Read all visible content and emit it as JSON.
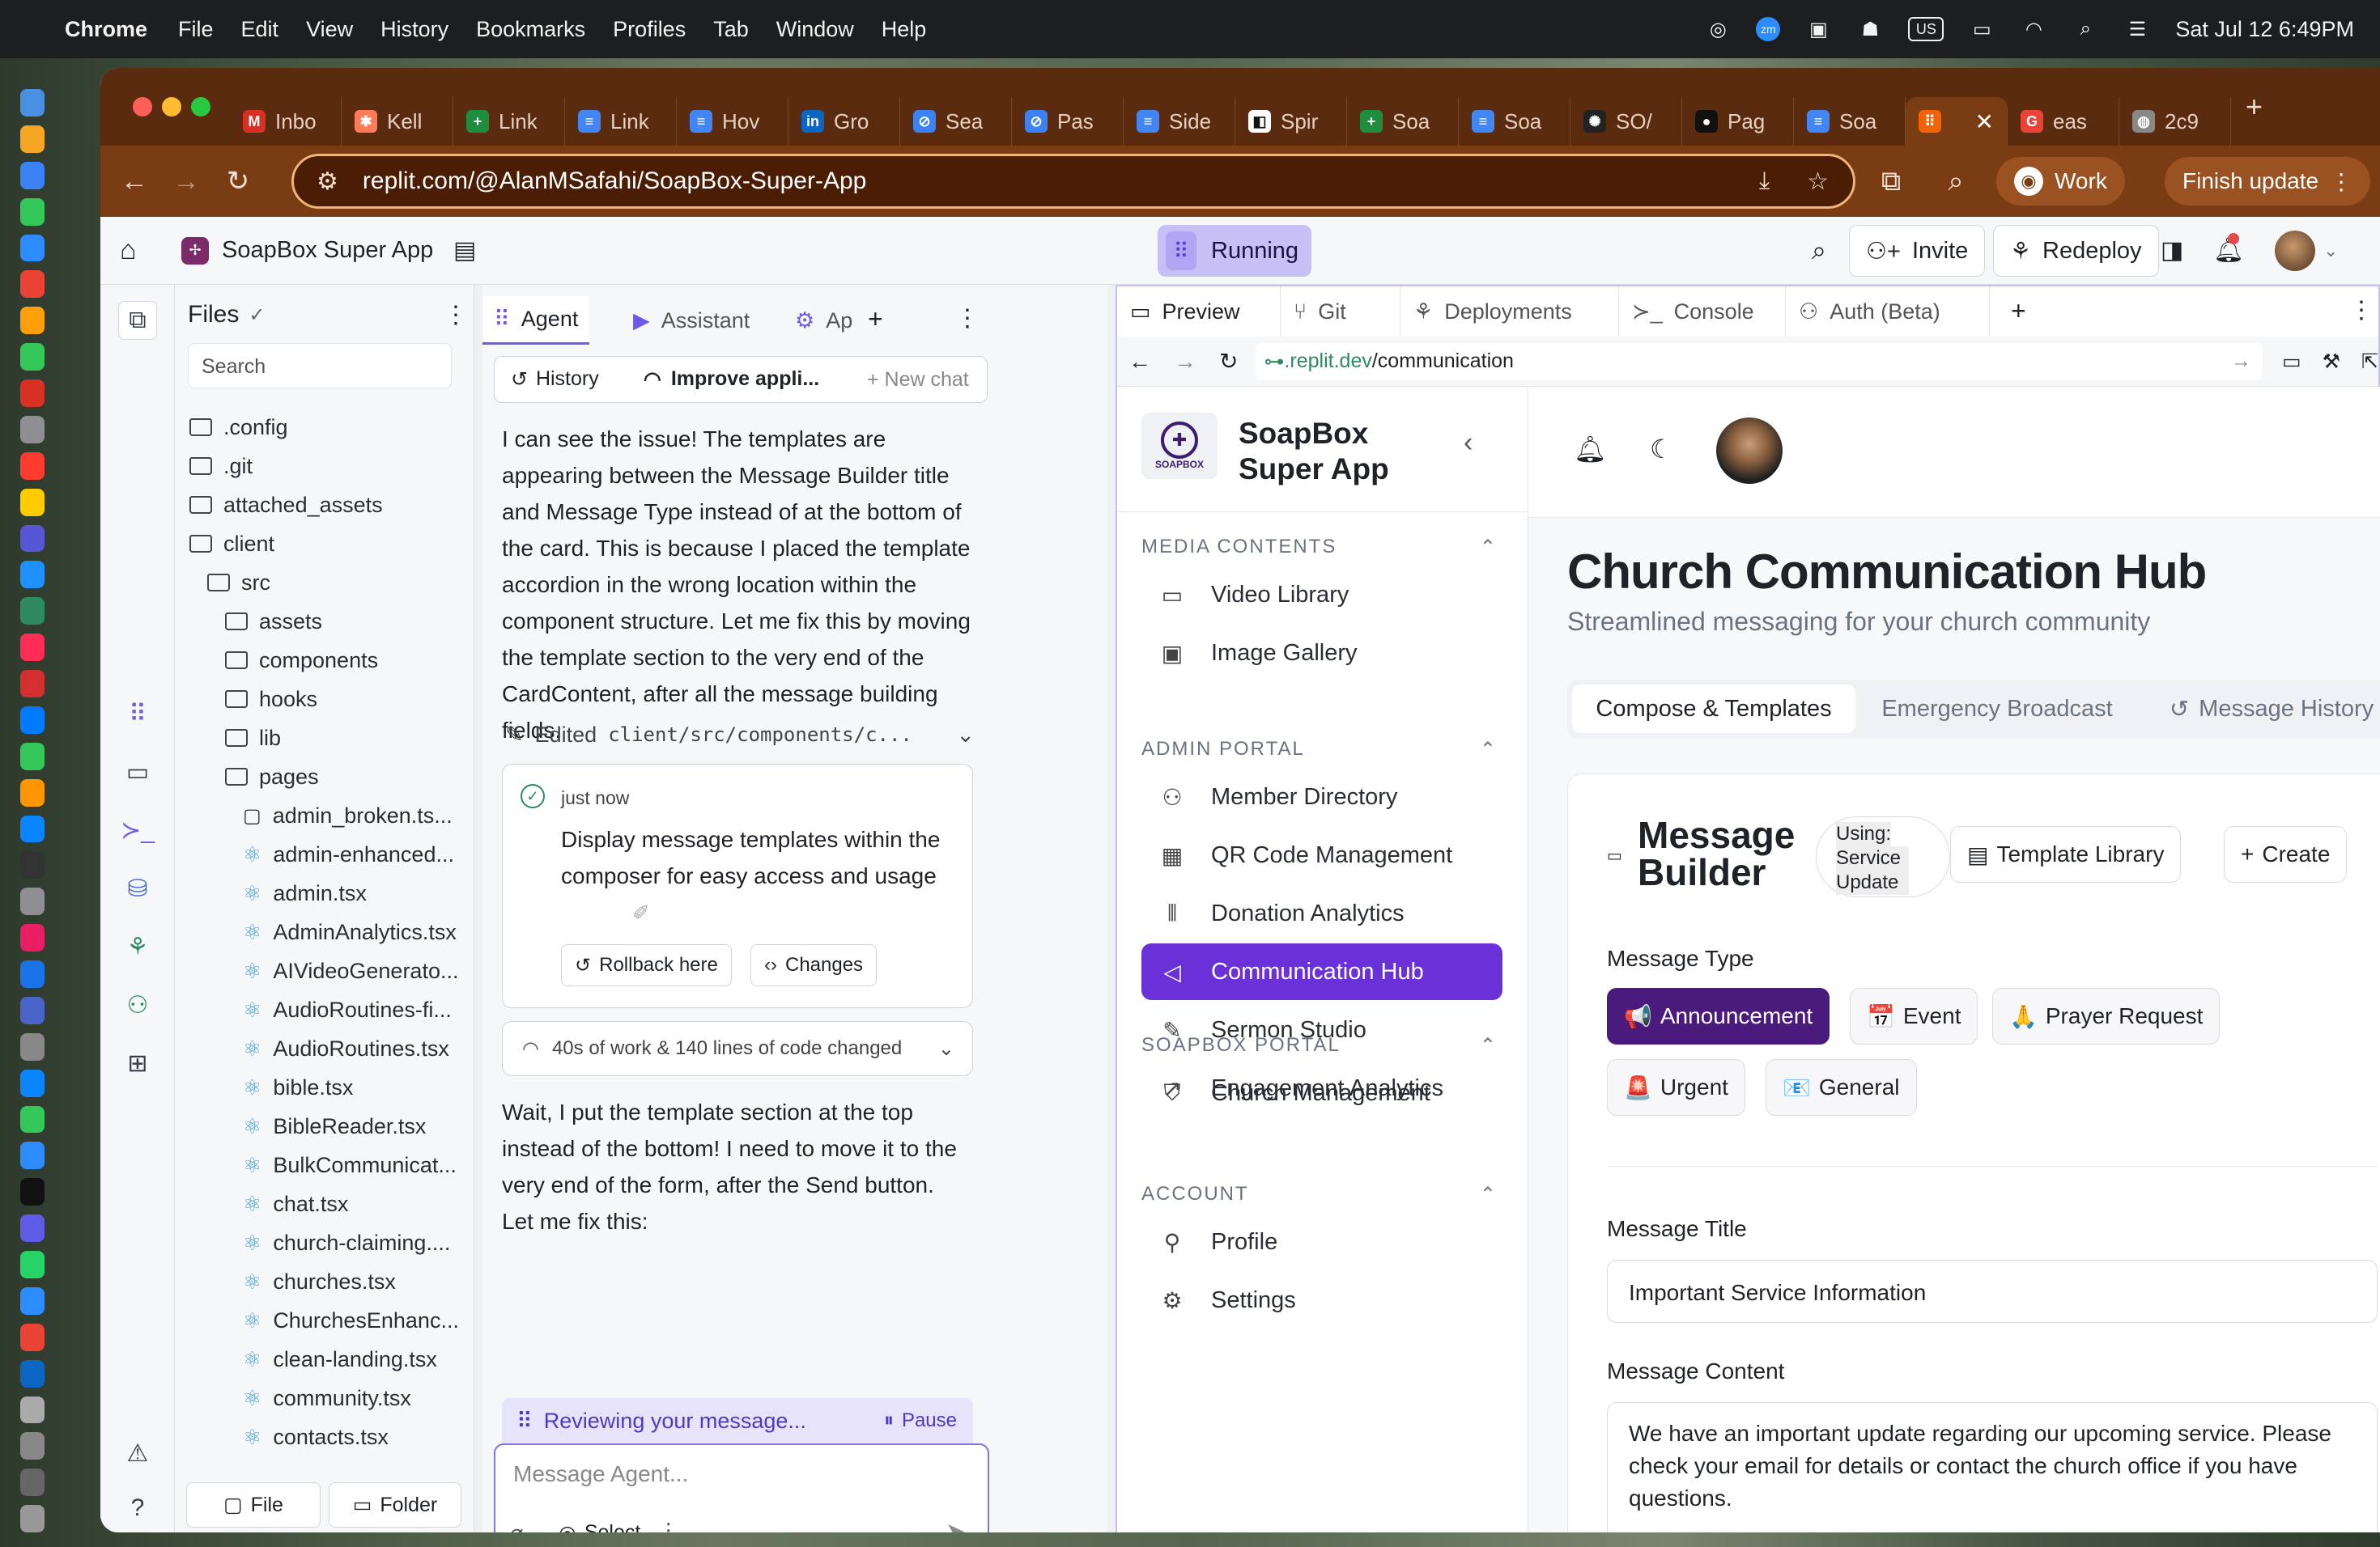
{
  "menubar": {
    "app": "Chrome",
    "items": [
      "File",
      "Edit",
      "View",
      "History",
      "Bookmarks",
      "Profiles",
      "Tab",
      "Window",
      "Help"
    ],
    "clock": "Sat Jul 12  6:49PM",
    "input_source": "US"
  },
  "browser": {
    "tabs": [
      {
        "label": "Inbo",
        "icon": "gmail-icon",
        "color": "#d93025",
        "glyph": "M"
      },
      {
        "label": "Kell",
        "icon": "hubspot-icon",
        "color": "#ff7a59",
        "glyph": "✱"
      },
      {
        "label": "Link",
        "icon": "sheets-icon",
        "color": "#1e8e3e",
        "glyph": "+"
      },
      {
        "label": "Link",
        "icon": "docs-icon",
        "color": "#4285f4",
        "glyph": "≡"
      },
      {
        "label": "Hov",
        "icon": "docs-icon",
        "color": "#4285f4",
        "glyph": "≡"
      },
      {
        "label": "Gro",
        "icon": "linkedin-icon",
        "color": "#0a66c2",
        "glyph": "in"
      },
      {
        "label": "Sea",
        "icon": "safari-icon",
        "color": "#3b82f6",
        "glyph": "⊘"
      },
      {
        "label": "Pas",
        "icon": "safari-icon",
        "color": "#3b82f6",
        "glyph": "⊘"
      },
      {
        "label": "Side",
        "icon": "docs-icon",
        "color": "#4285f4",
        "glyph": "≡"
      },
      {
        "label": "Spir",
        "icon": "notion-icon",
        "color": "#ffffff",
        "glyph": "◧"
      },
      {
        "label": "Soa",
        "icon": "sheets-icon",
        "color": "#1e8e3e",
        "glyph": "+"
      },
      {
        "label": "Soa",
        "icon": "docs-icon",
        "color": "#4285f4",
        "glyph": "≡"
      },
      {
        "label": "SO/",
        "icon": "openai-icon",
        "color": "#222",
        "glyph": "✺"
      },
      {
        "label": "Pag",
        "icon": "github-icon",
        "color": "#111",
        "glyph": "●"
      },
      {
        "label": "Soa",
        "icon": "docs-icon",
        "color": "#4285f4",
        "glyph": "≡"
      },
      {
        "label": "",
        "icon": "replit-icon",
        "color": "#f26207",
        "glyph": "⠿",
        "active": true
      },
      {
        "label": "eas",
        "icon": "google-icon",
        "color": "#ea4335",
        "glyph": "G"
      },
      {
        "label": "2c9",
        "icon": "globe-icon",
        "color": "#888",
        "glyph": "◍"
      }
    ],
    "url": "replit.com/@AlanMSafahi/SoapBox-Super-App",
    "profile": "Work",
    "update": "Finish update"
  },
  "replit": {
    "project": "SoapBox Super App",
    "status": "Running",
    "invite": "Invite",
    "redeploy": "Redeploy",
    "files": {
      "title": "Files",
      "search_placeholder": "Search",
      "tree": [
        {
          "name": ".config",
          "type": "folder",
          "depth": 0
        },
        {
          "name": ".git",
          "type": "folder",
          "depth": 0
        },
        {
          "name": "attached_assets",
          "type": "folder",
          "depth": 0
        },
        {
          "name": "client",
          "type": "folder-open",
          "depth": 0
        },
        {
          "name": "src",
          "type": "folder-open",
          "depth": 1
        },
        {
          "name": "assets",
          "type": "folder",
          "depth": 2
        },
        {
          "name": "components",
          "type": "folder",
          "depth": 2
        },
        {
          "name": "hooks",
          "type": "folder",
          "depth": 2
        },
        {
          "name": "lib",
          "type": "folder",
          "depth": 2
        },
        {
          "name": "pages",
          "type": "folder-open",
          "depth": 2
        },
        {
          "name": "admin_broken.ts...",
          "type": "file",
          "depth": 3
        },
        {
          "name": "admin-enhanced...",
          "type": "react",
          "depth": 3
        },
        {
          "name": "admin.tsx",
          "type": "react",
          "depth": 3
        },
        {
          "name": "AdminAnalytics.tsx",
          "type": "react",
          "depth": 3
        },
        {
          "name": "AIVideoGenerato...",
          "type": "react",
          "depth": 3
        },
        {
          "name": "AudioRoutines-fi...",
          "type": "react",
          "depth": 3
        },
        {
          "name": "AudioRoutines.tsx",
          "type": "react",
          "depth": 3
        },
        {
          "name": "bible.tsx",
          "type": "react",
          "depth": 3
        },
        {
          "name": "BibleReader.tsx",
          "type": "react",
          "depth": 3
        },
        {
          "name": "BulkCommunicat...",
          "type": "react",
          "depth": 3
        },
        {
          "name": "chat.tsx",
          "type": "react",
          "depth": 3
        },
        {
          "name": "church-claiming....",
          "type": "react",
          "depth": 3
        },
        {
          "name": "churches.tsx",
          "type": "react",
          "depth": 3
        },
        {
          "name": "ChurchesEnhanc...",
          "type": "react",
          "depth": 3
        },
        {
          "name": "clean-landing.tsx",
          "type": "react",
          "depth": 3
        },
        {
          "name": "community.tsx",
          "type": "react",
          "depth": 3
        },
        {
          "name": "contacts.tsx",
          "type": "react",
          "depth": 3
        }
      ],
      "new_file": "File",
      "new_folder": "Folder"
    },
    "agent": {
      "tabs": [
        "Agent",
        "Assistant",
        "Ap"
      ],
      "history": "History",
      "chat_title": "Improve appli...",
      "new_chat": "+ New chat",
      "msg1": "I can see the issue! The templates are appearing between the Message Builder title and Message Type instead of at the bottom of the card. This is because I placed the template accordion in the wrong location within the component structure. Let me fix this by moving the template section to the very end of the CardContent, after all the message building fields.",
      "edited": "Edited",
      "edited_path": "client/src/components/c...",
      "checkpoint_time": "just now",
      "checkpoint_text": "Display message templates within the composer for easy access and usage",
      "rollback": "Rollback here",
      "changes": "Changes",
      "work_summary": "40s of work & 140 lines of code changed",
      "msg2": "Wait, I put the template section at the top instead of the bottom! I need to move it to the very end of the form, after the Send button. Let me fix this:",
      "reviewing": "Reviewing your message...",
      "pause": "Pause",
      "input_placeholder": "Message Agent...",
      "select": "Select"
    },
    "preview": {
      "tabs": [
        "Preview",
        "Git",
        "Deployments",
        "Console",
        "Auth (Beta)"
      ],
      "url_host": ".replit.dev",
      "url_path": "/communication"
    }
  },
  "site": {
    "brand": {
      "line1": "SoapBox",
      "line2": "Super App",
      "logo_text": "SOAPBOX"
    },
    "sections": [
      {
        "title": "MEDIA CONTENTS",
        "items": [
          {
            "label": "Video Library",
            "icon": "video-icon",
            "glyph": "▭"
          },
          {
            "label": "Image Gallery",
            "icon": "image-icon",
            "glyph": "▣"
          }
        ]
      },
      {
        "title": "ADMIN PORTAL",
        "items": [
          {
            "label": "Member Directory",
            "icon": "users-icon",
            "glyph": "⚇"
          },
          {
            "label": "QR Code Management",
            "icon": "qr-code-icon",
            "glyph": "▦"
          },
          {
            "label": "Donation Analytics",
            "icon": "bar-chart-icon",
            "glyph": "⫴"
          },
          {
            "label": "Communication Hub",
            "icon": "megaphone-icon",
            "glyph": "◁",
            "active": true
          },
          {
            "label": "Sermon Studio",
            "icon": "pen-icon",
            "glyph": "✎"
          },
          {
            "label": "Engagement Analytics",
            "icon": "trend-icon",
            "glyph": "↗"
          }
        ]
      },
      {
        "title": "SOAPBOX PORTAL",
        "items": [
          {
            "label": "Church Management",
            "icon": "shield-icon",
            "glyph": "⛉"
          }
        ]
      },
      {
        "title": "ACCOUNT",
        "items": [
          {
            "label": "Profile",
            "icon": "user-icon",
            "glyph": "⚲"
          },
          {
            "label": "Settings",
            "icon": "gear-icon",
            "glyph": "⚙"
          }
        ]
      }
    ],
    "page_title": "Church Communication Hub",
    "page_subtitle": "Streamlined messaging for your church community",
    "tabs": [
      "Compose & Templates",
      "Emergency Broadcast",
      "Message History"
    ],
    "builder": {
      "title_line1": "Message",
      "title_line2": "Builder",
      "using_label": "Using:",
      "using_value": "Service Update",
      "template_library": "Template Library",
      "create": "Create",
      "type_label": "Message Type",
      "types": [
        {
          "label": "Announcement",
          "emoji": "📢",
          "active": true
        },
        {
          "label": "Event",
          "emoji": "📅"
        },
        {
          "label": "Prayer Request",
          "emoji": "🙏"
        },
        {
          "label": "Urgent",
          "emoji": "🚨"
        },
        {
          "label": "General",
          "emoji": "📧"
        }
      ],
      "title_field_label": "Message Title",
      "title_value": "Important Service Information",
      "content_label": "Message Content",
      "content_value": "We have an important update regarding our upcoming service. Please check your email for details or contact the church office if you have questions."
    }
  }
}
